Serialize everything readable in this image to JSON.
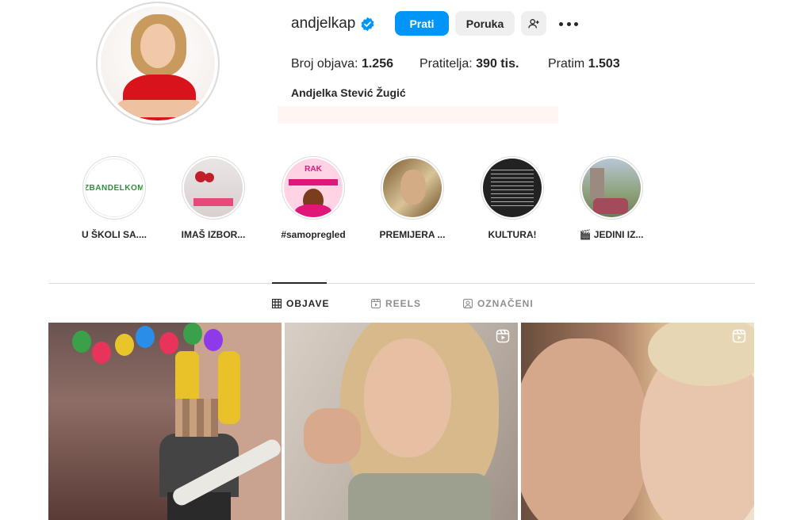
{
  "profile": {
    "username": "andjelkap",
    "full_name": "Andjelka Stević Žugić",
    "verified": true,
    "buttons": {
      "follow": "Prati",
      "message": "Poruka"
    },
    "stats": {
      "posts_label": "Broj objava:",
      "posts_value": "1.256",
      "followers_label": "Pratitelja:",
      "followers_value": "390 tis.",
      "following_label": "Pratim",
      "following_value": "1.503"
    }
  },
  "highlights": [
    {
      "label": "U ŠKOLI SA....",
      "icon": "school-logo"
    },
    {
      "label": "IMAŠ IZBOR...",
      "icon": "cherries"
    },
    {
      "label": "#samopregled",
      "icon": "rak-campaign"
    },
    {
      "label": "PREMIJERA ...",
      "icon": "portrait"
    },
    {
      "label": "KULTURA!",
      "icon": "text-note"
    },
    {
      "label": "🎬 JEDINI IZ...",
      "icon": "street-photo"
    }
  ],
  "highlight_logo_text": "ZBANDELKOM",
  "highlight_rak_text": "RAK",
  "tabs": [
    {
      "label": "OBJAVE",
      "icon": "grid-icon",
      "active": true
    },
    {
      "label": "REELS",
      "icon": "reels-icon",
      "active": false
    },
    {
      "label": "OZNAČENI",
      "icon": "tagged-icon",
      "active": false
    }
  ],
  "posts": [
    {
      "type": "photo",
      "description_icon": "guitar-photo"
    },
    {
      "type": "reel",
      "description_icon": "reel-icon"
    },
    {
      "type": "reel",
      "description_icon": "reel-icon"
    }
  ],
  "colors": {
    "primary": "#0095f6",
    "text": "#262626",
    "muted": "#8e8e8e",
    "divider": "#dbdbdb"
  }
}
